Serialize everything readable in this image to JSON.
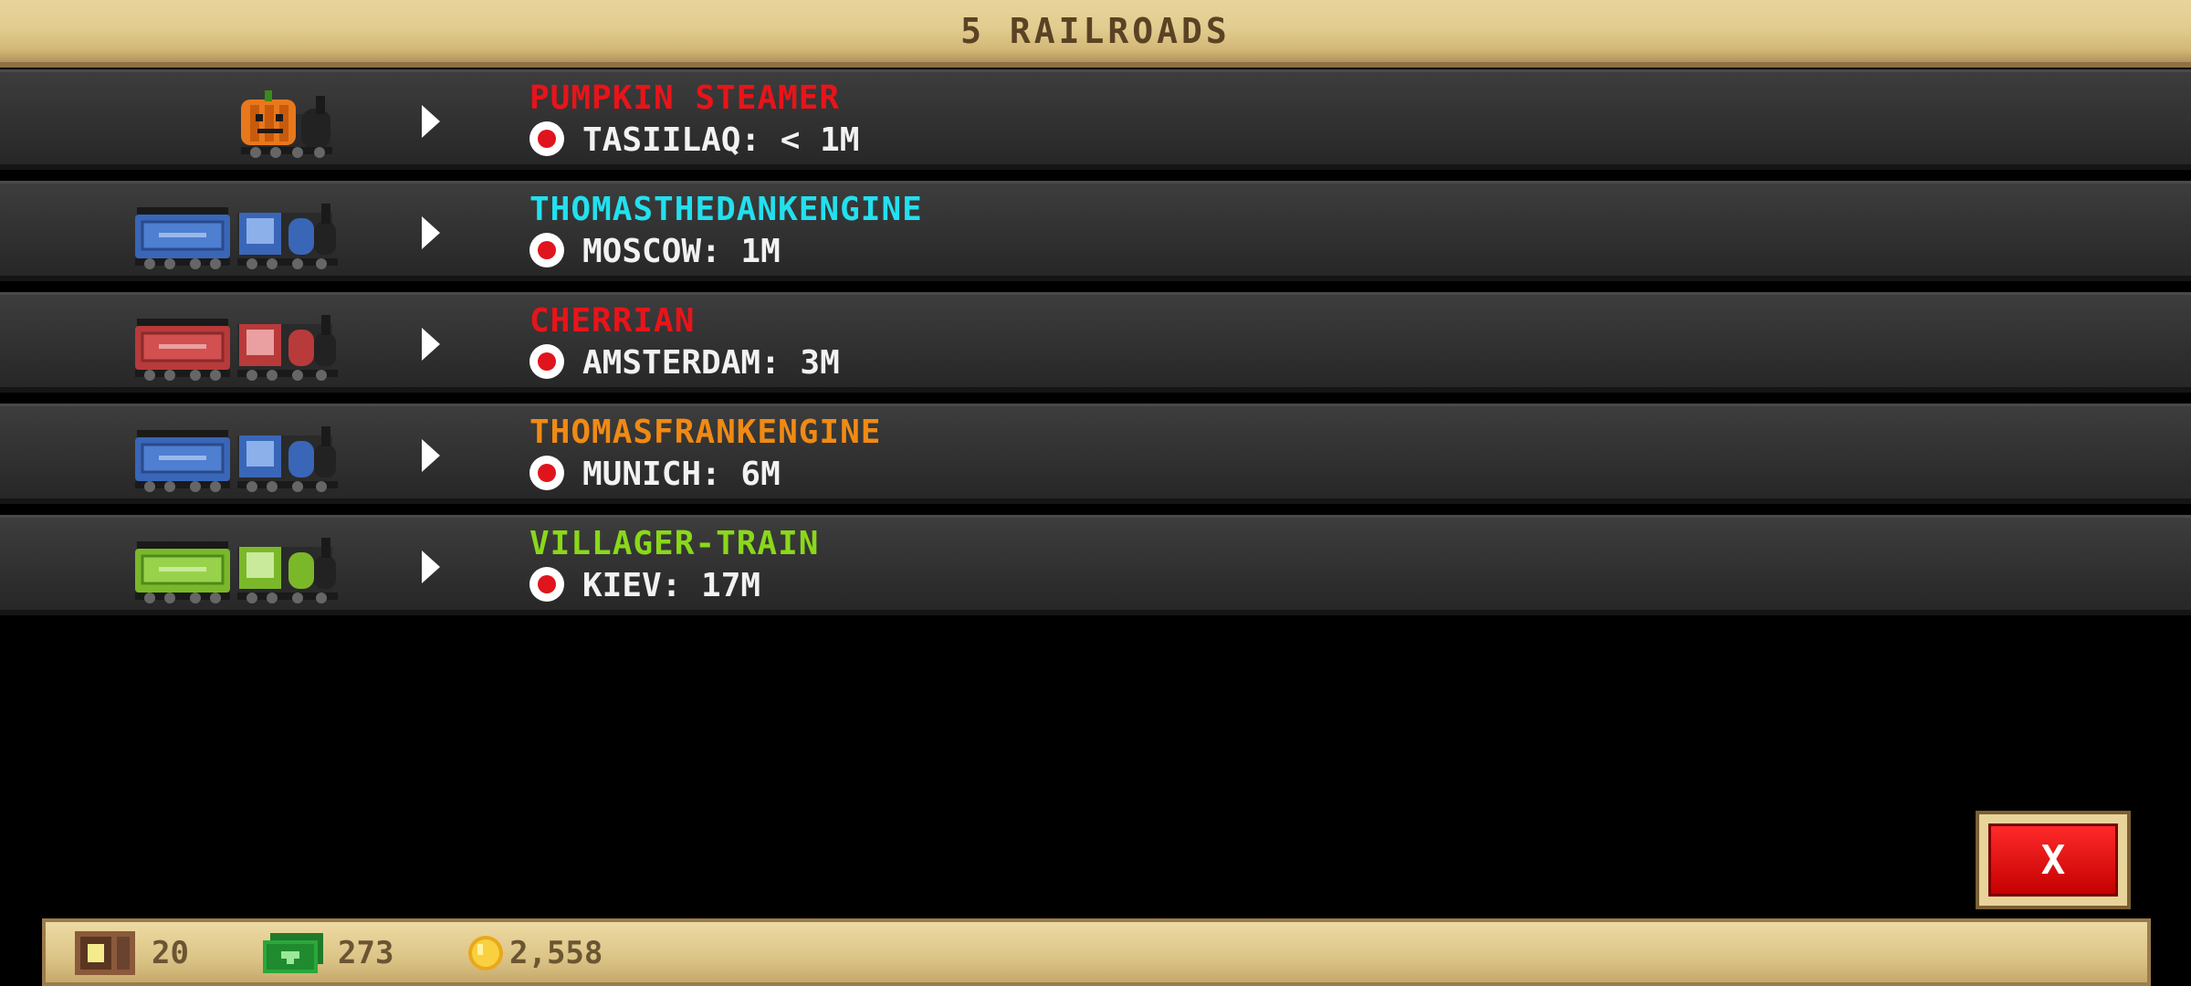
{
  "header": {
    "title": "5 RAILROADS"
  },
  "railroads": [
    {
      "name": "PUMPKIN STEAMER",
      "name_color": "#e8141a",
      "city": "TASIILAQ: < 1M",
      "train": "pumpkin"
    },
    {
      "name": "THOMASTHEDANKENGINE",
      "name_color": "#23e0ee",
      "city": "MOSCOW: 1M",
      "train": "blue"
    },
    {
      "name": "CHERRIAN",
      "name_color": "#e8141a",
      "city": "AMSTERDAM: 3M",
      "train": "red"
    },
    {
      "name": "THOMASFRANKENGINE",
      "name_color": "#f08a14",
      "city": "MUNICH: 6M",
      "train": "blue"
    },
    {
      "name": "VILLAGER-TRAIN",
      "name_color": "#8ad81a",
      "city": "KIEV: 17M",
      "train": "green"
    }
  ],
  "close_button": {
    "label": "X"
  },
  "resources": {
    "crates": "20",
    "cash": "273",
    "coins": "2,558"
  },
  "colors": {
    "header_bg": "#e2cc8f",
    "row_bg": "#333333",
    "close_red": "#e81c1c"
  }
}
